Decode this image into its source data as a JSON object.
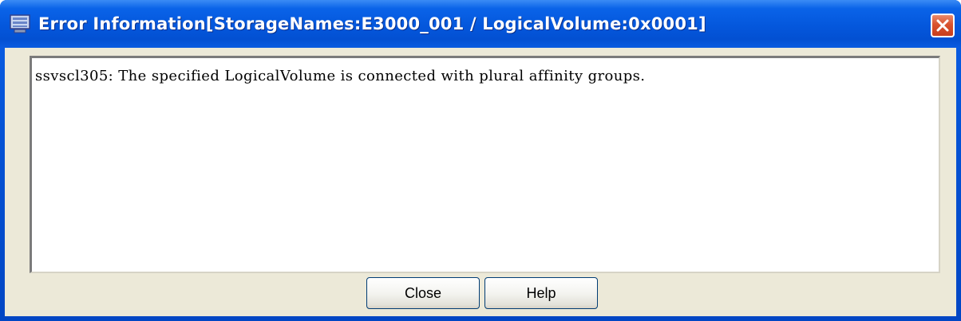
{
  "window": {
    "title": "Error Information[StorageNames:E3000_001 / LogicalVolume:0x0001]",
    "title_icon": "storage-app-icon",
    "close_icon": "close-x-icon",
    "accent_color": "#0553d6",
    "close_color": "#d9532f"
  },
  "message": {
    "text": "ssvscl305: The specified LogicalVolume is connected with plural affinity groups."
  },
  "buttons": {
    "close_label": "Close",
    "help_label": "Help"
  }
}
